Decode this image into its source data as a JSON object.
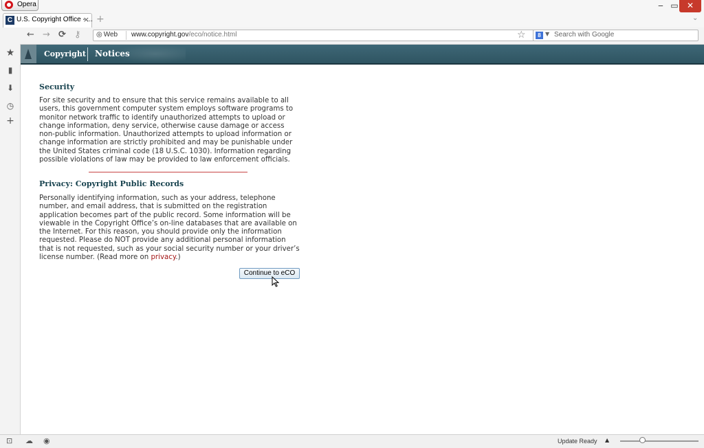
{
  "window": {
    "app_label": "Opera",
    "min_glyph": "‒",
    "max_glyph": "▭",
    "close_glyph": "✕"
  },
  "tabs": [
    {
      "title": "U.S. Copyright Office - ...",
      "favicon": "C",
      "close": "×"
    }
  ],
  "new_tab_glyph": "+",
  "tab_menu_glyph": "⌄",
  "toolbar": {
    "back": "←",
    "forward": "→",
    "reload": "⟳",
    "key": "⚷",
    "web_label": "Web",
    "url_domain": "www.copyright.gov",
    "url_path": "/eco/notice.html",
    "star": "☆",
    "search_engine_glyph": "8",
    "search_drop": "▼",
    "search_placeholder": "Search with Google"
  },
  "sidebar": {
    "items": [
      {
        "icon": "bookmarks-star-icon",
        "glyph": "★"
      },
      {
        "icon": "notes-icon",
        "glyph": "▮"
      },
      {
        "icon": "downloads-icon",
        "glyph": "⬇"
      },
      {
        "icon": "history-clock-icon",
        "glyph": "◷"
      },
      {
        "icon": "add-panel-icon",
        "glyph": "+"
      }
    ]
  },
  "banner": {
    "brand": "Copyright",
    "title": "Notices"
  },
  "content": {
    "security_heading": "Security",
    "security_text": "For site security and to ensure that this service remains available to all users, this government computer system employs software programs to monitor network traffic to identify unauthorized attempts to upload or change information, deny service, otherwise cause damage or access non-public information. Unauthorized attempts to upload information or change information are strictly prohibited and may be punishable under the United States criminal code (18 U.S.C. 1030). Information regarding possible violations of law may be provided to law enforcement officials.",
    "privacy_heading": "Privacy: Copyright Public Records",
    "privacy_text": "Personally identifying information, such as your address, telephone number, and email address, that is submitted on the registration application becomes part of the public record. Some information will be viewable in the Copyright Office’s on-line databases that are available on the Internet. For this reason, you should provide only the information requested. Please do NOT provide any additional personal information that is not requested, such as your social security number or your driver’s license number. (Read more on ",
    "privacy_link": "privacy",
    "privacy_tail": ".)",
    "continue_label": "Continue to eCO"
  },
  "statusbar": {
    "update_status": "Update Ready",
    "arrow": "▲",
    "icon1": "⊡",
    "icon2": "☁",
    "icon3": "◉"
  },
  "colors": {
    "banner": "#2f5562",
    "heading": "#17424e",
    "link": "#a31515",
    "close_button": "#c7392b"
  }
}
